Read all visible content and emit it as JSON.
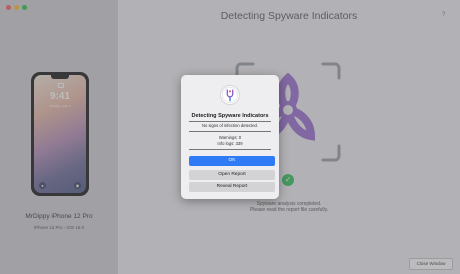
{
  "window": {
    "title": "Detecting Spyware Indicators",
    "help_label": "?",
    "close_window_label": "Close Window",
    "traffic_light_colors": [
      "#fe5f57",
      "#febc2e",
      "#28c840"
    ]
  },
  "sidebar": {
    "phone": {
      "time": "9:41",
      "date": "Monday, June 6",
      "icons": [
        "flashlight-icon",
        "camera-icon"
      ]
    },
    "device_name": "MrDippy iPhone 12 Pro",
    "device_details": "iPhone 12 Pro - iOS 15.0"
  },
  "main": {
    "status_line1": "Spyware analysis completed.",
    "status_line2": "Please read the report file carefully.",
    "status_icon": "checkmark-icon",
    "status_color": "#33c35b",
    "big_icon": "biohazard-icon",
    "big_icon_color": "#9b6fcf"
  },
  "dialog": {
    "title": "Detecting Spyware Indicators",
    "message": "No signs of infection detected.",
    "warnings": "Warnings: 0",
    "info_logs": "Info logs: 339",
    "ok_label": "OK",
    "open_report_label": "Open Report",
    "reveal_report_label": "Reveal Report",
    "accent_color": "#2f7bf6",
    "icon": "tuning-fork-icon"
  }
}
